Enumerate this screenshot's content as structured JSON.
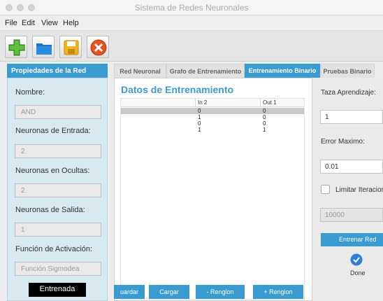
{
  "window": {
    "title": "Sistema de Redes Neuronales"
  },
  "menu": {
    "file": "File",
    "edit": "Edit",
    "view": "View",
    "help": "Help"
  },
  "toolbar": {
    "icons": [
      "add-icon",
      "folder-icon",
      "save-icon",
      "close-icon"
    ]
  },
  "left": {
    "tab_label": "Propiedades de la Red",
    "nombre_label": "Nombre:",
    "nombre_value": "AND",
    "entrada_label": "Neuronas de Entrada:",
    "entrada_value": "2",
    "ocultas_label": "Neuronas en Ocultas:",
    "ocultas_value": "2",
    "salida_label": "Neuronas de Salida:",
    "salida_value": "1",
    "activacion_label": "Función de Activación:",
    "activacion_placeholder": "Función Sigmodea",
    "status": "Entrenada"
  },
  "tabs": [
    {
      "label": "Red Neuronal"
    },
    {
      "label": "Grafo de Entrenamiento"
    },
    {
      "label": "Entrenamiento Binario"
    },
    {
      "label": "Pruebas Binario"
    }
  ],
  "center": {
    "title": "Datos de Entrenamiento",
    "table": {
      "headers": [
        "",
        "In 2",
        "Out 1"
      ],
      "rows": [
        {
          "in1": "",
          "in2": "0",
          "out": "0"
        },
        {
          "in1": "",
          "in2": "1",
          "out": "0"
        },
        {
          "in1": "",
          "in2": "0",
          "out": "0"
        },
        {
          "in1": "",
          "in2": "1",
          "out": "1"
        }
      ]
    },
    "buttons": {
      "guardar": "uardar",
      "cargar": "Cargar",
      "menos": "- Renglon",
      "mas": "+ Renglon"
    }
  },
  "right": {
    "taza_label": "Taza Aprendizaje:",
    "taza_value": "1",
    "error_label": "Error Maximo:",
    "error_value": "0.01",
    "limitar_label": "Limitar Iteraciones",
    "iter_placeholder": "10000",
    "entrenar_label": "Entrenar Red",
    "done_label": "Done"
  },
  "colors": {
    "accent": "#3a9bd1",
    "panel": "#d9e9f2"
  }
}
